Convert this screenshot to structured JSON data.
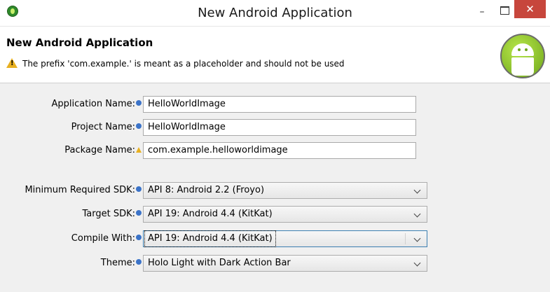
{
  "window": {
    "title": "New Android Application",
    "icons": {
      "app": "eclipse-adt-icon",
      "minimize": "minimize-icon",
      "maximize": "maximize-icon",
      "close": "close-icon"
    },
    "minimize_glyph": "–",
    "close_glyph": "✕",
    "close_color": "#c7463c"
  },
  "header": {
    "title": "New Android Application",
    "warning": "The prefix 'com.example.' is meant as a placeholder and should not be used",
    "logo": "android-logo-icon"
  },
  "form": {
    "application_name": {
      "label": "Application Name:",
      "value": "HelloWorldImage",
      "icon": "info-icon"
    },
    "project_name": {
      "label": "Project Name:",
      "value": "HelloWorldImage",
      "icon": "info-icon"
    },
    "package_name": {
      "label": "Package Name:",
      "value": "com.example.helloworldimage",
      "icon": "warning-icon"
    },
    "min_sdk": {
      "label": "Minimum Required SDK:",
      "value": "API 8: Android 2.2 (Froyo)",
      "icon": "info-icon"
    },
    "target_sdk": {
      "label": "Target SDK:",
      "value": "API 19: Android 4.4 (KitKat)",
      "icon": "info-icon"
    },
    "compile_with": {
      "label": "Compile With:",
      "value": "API 19: Android 4.4 (KitKat)",
      "icon": "info-icon"
    },
    "theme": {
      "label": "Theme:",
      "value": "Holo Light with Dark Action Bar",
      "icon": "info-icon"
    }
  },
  "colors": {
    "info": "#3b73c8",
    "warning": "#e8b020",
    "accent": "#3c7fb1"
  }
}
